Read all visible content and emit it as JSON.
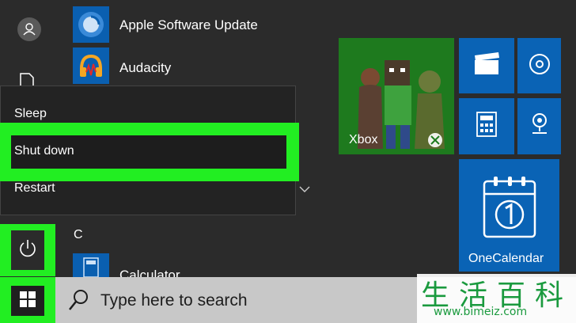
{
  "app_list": [
    {
      "label": "Apple Software Update",
      "icon": "apple-update-icon"
    },
    {
      "label": "Audacity",
      "icon": "audacity-icon"
    }
  ],
  "section_letter": "C",
  "partial_app": {
    "label": "Calculator",
    "icon": "calculator-icon"
  },
  "power_menu": {
    "items": [
      {
        "label": "Sleep"
      },
      {
        "label": "Shut down"
      },
      {
        "label": "Restart"
      }
    ]
  },
  "tiles": {
    "xbox_label": "Xbox",
    "onecalendar_label": "OneCalendar"
  },
  "search": {
    "placeholder": "Type here to search"
  },
  "watermark": {
    "chars": "生活百科",
    "url": "www.bimeiz.com"
  },
  "colors": {
    "highlight": "#22ee22",
    "tile_blue": "#0a63b5",
    "xbox_green": "#1e7a1e",
    "taskbar": "#c8c8c8"
  }
}
